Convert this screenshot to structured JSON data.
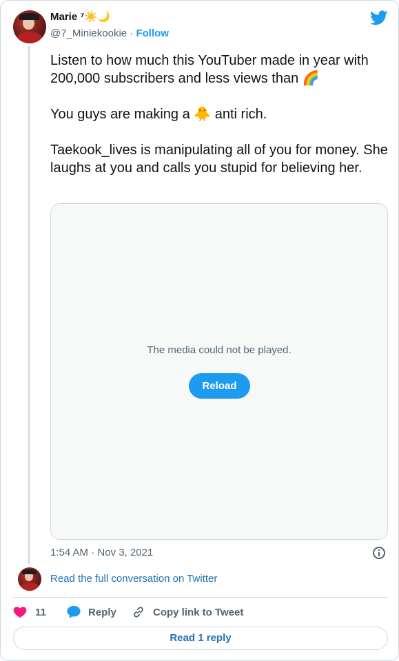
{
  "author": {
    "display_name": "Marie ⁷☀️🌙",
    "handle": "@7_Miniekookie",
    "separator": " · ",
    "follow_label": "Follow"
  },
  "tweet": {
    "text": "Listen to how much this YouTuber made in year with 200,000 subscribers and less views than 🌈\n\nYou guys are making a 🐥 anti rich.\n\nTaekook_lives is manipulating all of you for money. She laughs at you and calls you stupid for believing her.",
    "timestamp": "1:54 AM · Nov 3, 2021"
  },
  "media": {
    "error_message": "The media could not be played.",
    "reload_label": "Reload"
  },
  "conversation": {
    "link_text": "Read the full conversation on Twitter"
  },
  "actions": {
    "like_count": "11",
    "reply_label": "Reply",
    "copy_link_label": "Copy link to Tweet"
  },
  "footer": {
    "read_replies_label": "Read 1 reply"
  },
  "colors": {
    "brand_blue": "#1d9bf0",
    "like_pink": "#f91880",
    "muted_text": "#536471"
  },
  "icons": [
    "twitter-bird-icon",
    "info-icon",
    "heart-icon",
    "reply-bubble-icon",
    "link-icon"
  ]
}
